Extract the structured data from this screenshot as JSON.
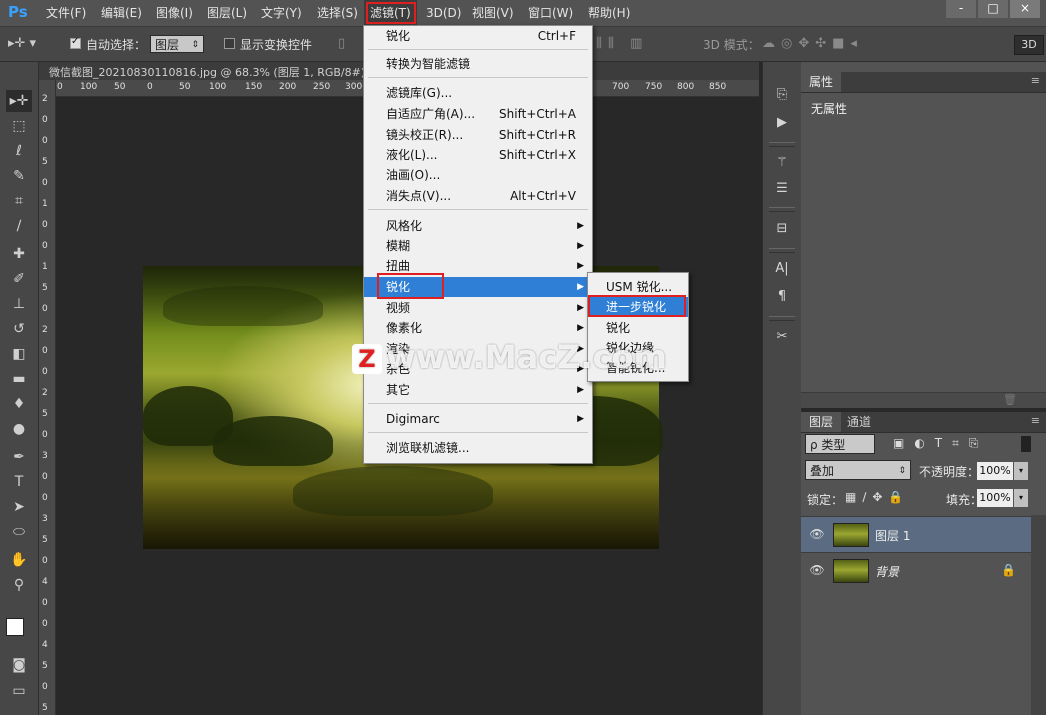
{
  "app": {
    "logo": "Ps"
  },
  "menubar": {
    "items": [
      "文件(F)",
      "编辑(E)",
      "图像(I)",
      "图层(L)",
      "文字(Y)",
      "选择(S)",
      "滤镜(T)",
      "3D(D)",
      "视图(V)",
      "窗口(W)",
      "帮助(H)"
    ],
    "window_controls": [
      "-",
      "□",
      "×"
    ]
  },
  "options_bar": {
    "auto_select_label": "自动选择：",
    "auto_select_value": "图层",
    "show_transform_label": "显示变换控件",
    "mode_3d_label": "3D 模式：",
    "btn_3d": "3D"
  },
  "document": {
    "tab_title": "微信截图_20210830110816.jpg @ 68.3% (图层 1, RGB/8#) *",
    "ruler_top": [
      "0",
      "100",
      "50",
      "0",
      "50",
      "100",
      "150",
      "200",
      "250",
      "300",
      "700",
      "750",
      "800",
      "850"
    ],
    "ruler_left": [
      "2",
      "0",
      "0",
      "5",
      "0",
      "1",
      "0",
      "0",
      "1",
      "5",
      "0",
      "2",
      "0",
      "0",
      "2",
      "5",
      "0",
      "3",
      "0",
      "0",
      "3",
      "5",
      "0",
      "4",
      "0",
      "0",
      "4",
      "5",
      "0",
      "5"
    ]
  },
  "filter_menu": {
    "items": [
      {
        "label": "锐化",
        "shortcut": "Ctrl+F"
      },
      {
        "label": "转换为智能滤镜"
      },
      {
        "label": "滤镜库(G)..."
      },
      {
        "label": "自适应广角(A)...",
        "shortcut": "Shift+Ctrl+A"
      },
      {
        "label": "镜头校正(R)...",
        "shortcut": "Shift+Ctrl+R"
      },
      {
        "label": "液化(L)...",
        "shortcut": "Shift+Ctrl+X"
      },
      {
        "label": "油画(O)..."
      },
      {
        "label": "消失点(V)...",
        "shortcut": "Alt+Ctrl+V"
      },
      {
        "label": "风格化"
      },
      {
        "label": "模糊"
      },
      {
        "label": "扭曲"
      },
      {
        "label": "锐化"
      },
      {
        "label": "视频"
      },
      {
        "label": "像素化"
      },
      {
        "label": "渲染"
      },
      {
        "label": "杂色"
      },
      {
        "label": "其它"
      },
      {
        "label": "Digimarc"
      },
      {
        "label": "浏览联机滤镜..."
      }
    ]
  },
  "sharpen_submenu": {
    "items": [
      "USM 锐化...",
      "进一步锐化",
      "锐化",
      "锐化边缘",
      "智能锐化..."
    ]
  },
  "watermark": {
    "logo": "Z",
    "text": "www.MacZ.com"
  },
  "properties_panel": {
    "tab": "属性",
    "body": "无属性"
  },
  "layers_panel": {
    "tabs": [
      "图层",
      "通道"
    ],
    "filter_type": "ρ 类型",
    "blend_mode": "叠加",
    "opacity_label": "不透明度：",
    "opacity_value": "100%",
    "lock_label": "锁定：",
    "fill_label": "填充：",
    "fill_value": "100%",
    "layers": [
      {
        "name": "图层 1",
        "selected": true
      },
      {
        "name": "背景",
        "selected": false
      }
    ]
  },
  "colors": {
    "menu_highlight": "#2f7fd6",
    "annotation_red": "#e02020",
    "ps_blue": "#3aa0ff"
  }
}
